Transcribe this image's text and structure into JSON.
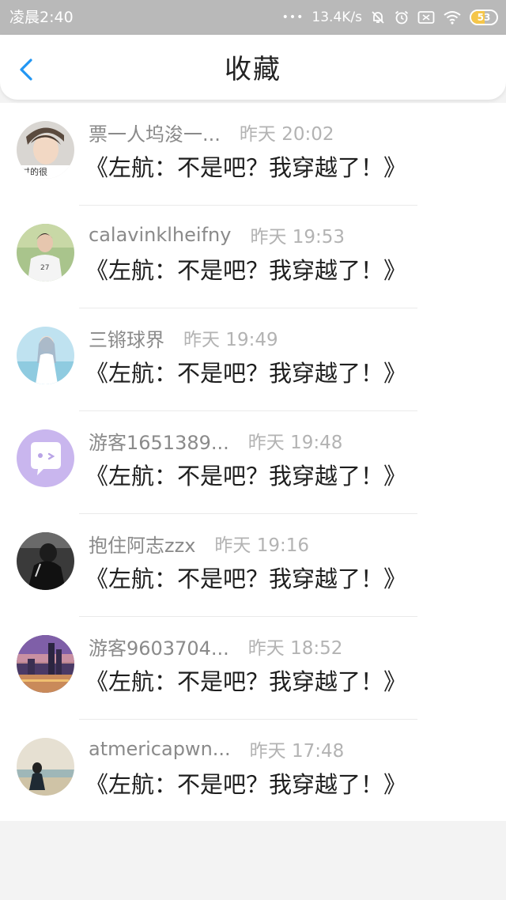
{
  "status_bar": {
    "time": "凌晨2:40",
    "dots": "•••",
    "speed": "13.4K/s",
    "icons": [
      "mute-icon",
      "alarm-icon",
      "sim-icon",
      "wifi-icon"
    ],
    "battery": "53",
    "battery_level": 0.53,
    "battery_color": "#f5c64a",
    "background": "#b9b9b9"
  },
  "header": {
    "title": "收藏",
    "back_icon": "chevron-left-icon",
    "accent": "#2196f3"
  },
  "items": [
    {
      "username": "票一人坞浚一...",
      "time": "昨天 20:02",
      "title": "《左航：不是吧？我穿越了！》"
    },
    {
      "username": "calavinklheifny",
      "time": "昨天 19:53",
      "title": "《左航：不是吧？我穿越了！》"
    },
    {
      "username": "三锵球界",
      "time": "昨天 19:49",
      "title": "《左航：不是吧？我穿越了！》"
    },
    {
      "username": "游客1651389...",
      "time": "昨天 19:48",
      "title": "《左航：不是吧？我穿越了！》"
    },
    {
      "username": "抱住阿志zzx",
      "time": "昨天 19:16",
      "title": "《左航：不是吧？我穿越了！》"
    },
    {
      "username": "游客9603704...",
      "time": "昨天 18:52",
      "title": "《左航：不是吧？我穿越了！》"
    },
    {
      "username": "atmericapwn...",
      "time": "昨天 17:48",
      "title": "《左航：不是吧？我穿越了！》"
    }
  ]
}
